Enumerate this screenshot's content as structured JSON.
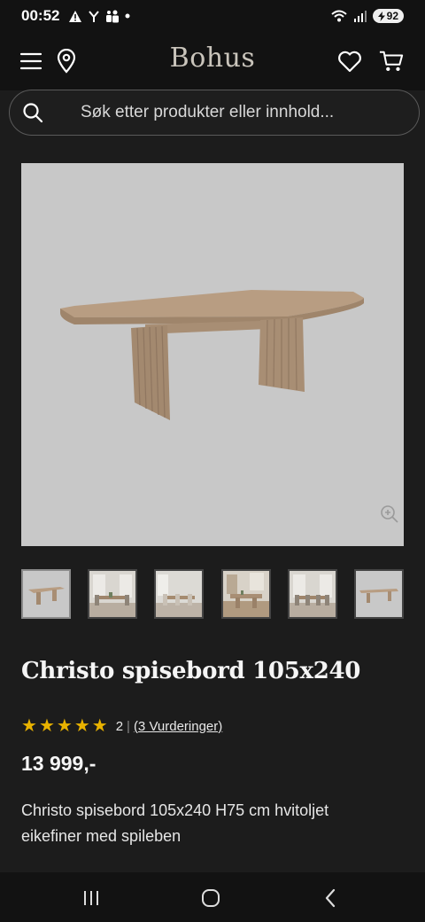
{
  "status_bar": {
    "time": "00:52",
    "battery": "92"
  },
  "header": {
    "logo": "Bohus",
    "icons": [
      "menu-icon",
      "location-pin-icon",
      "heart-icon",
      "cart-icon"
    ]
  },
  "search": {
    "placeholder": "Søk etter produkter eller innhold..."
  },
  "gallery": {
    "thumbnail_count": 6,
    "active_index": 0
  },
  "product": {
    "title": "Christo spisebord 105x240",
    "rating": 5,
    "rating_count": "2",
    "reviews_link": "(3 Vurderinger)",
    "price": "13 999,-",
    "description": "Christo spisebord 105x240 H75 cm hvitoljet eikefiner med spileben"
  },
  "colors": {
    "background": "#1c1c1c",
    "header": "#121212",
    "star": "#e8b200",
    "image_bg": "#c8c8c8"
  }
}
